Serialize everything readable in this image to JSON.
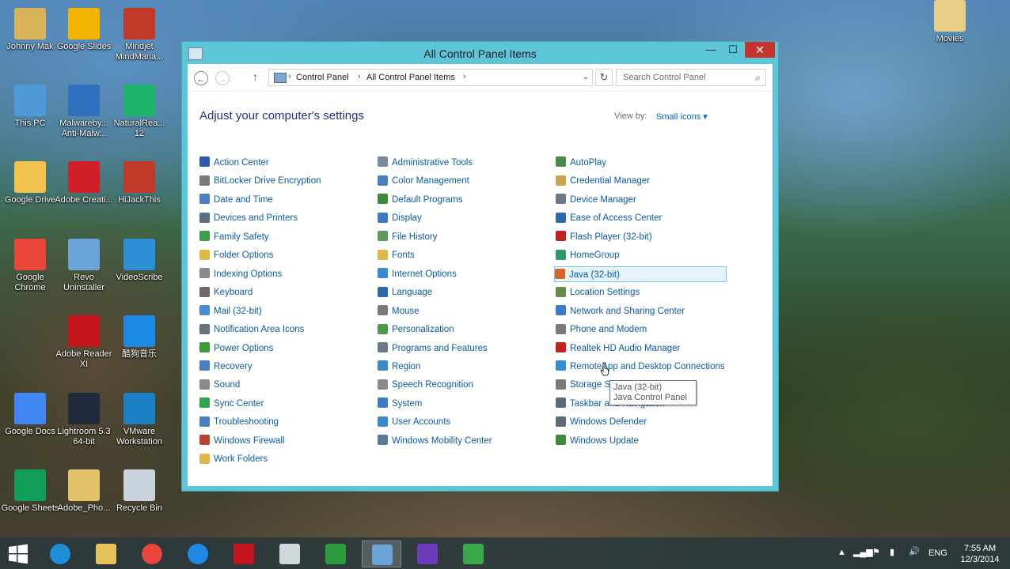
{
  "desktop": {
    "icons": [
      {
        "label": "Johnny Mak",
        "color": "#d9b35a",
        "icon": "folder-user-icon"
      },
      {
        "label": "Google Slides",
        "color": "#f3b400",
        "icon": "google-slides-icon"
      },
      {
        "label": "Mindjet MindMana...",
        "color": "#c0392b",
        "icon": "mindjet-icon"
      },
      {
        "label": "This PC",
        "color": "#4f9ad6",
        "icon": "computer-icon"
      },
      {
        "label": "Malwareby... Anti-Malw...",
        "color": "#2f6fbd",
        "icon": "malwarebytes-icon"
      },
      {
        "label": "NaturalRea... 12",
        "color": "#1fb36a",
        "icon": "naturalreader-icon"
      },
      {
        "label": "Google Drive",
        "color": "#f2c14e",
        "icon": "google-drive-icon"
      },
      {
        "label": "Adobe Creati...",
        "color": "#d11f2a",
        "icon": "adobe-cc-icon"
      },
      {
        "label": "HiJackThis",
        "color": "#c0392b",
        "icon": "hijackthis-icon"
      },
      {
        "label": "Google Chrome",
        "color": "#e9453a",
        "icon": "chrome-icon"
      },
      {
        "label": "Revo Uninstaller",
        "color": "#6ba4d8",
        "icon": "revo-icon"
      },
      {
        "label": "VideoScribe",
        "color": "#2e8fd6",
        "icon": "videoscribe-icon"
      },
      {
        "label": "Adobe Reader XI",
        "color": "#c4161c",
        "icon": "adobe-reader-icon"
      },
      {
        "label": "酷狗音乐",
        "color": "#1e88e5",
        "icon": "kugou-icon"
      },
      {
        "label": "Google Docs",
        "color": "#4285f4",
        "icon": "google-docs-icon"
      },
      {
        "label": "Lightroom 5.3 64-bit",
        "color": "#1f2b3a",
        "icon": "lightroom-icon"
      },
      {
        "label": "VMware Workstation",
        "color": "#1b7fc4",
        "icon": "vmware-icon"
      },
      {
        "label": "Google Sheets",
        "color": "#0f9d58",
        "icon": "google-sheets-icon"
      },
      {
        "label": "Adobe_Pho...",
        "color": "#e3c26a",
        "icon": "folder-icon"
      },
      {
        "label": "Recycle Bin",
        "color": "#c9d3dc",
        "icon": "recycle-bin-icon"
      },
      {
        "label": "Movies",
        "color": "#e8cf86",
        "icon": "folder-movies-icon"
      }
    ]
  },
  "window": {
    "title": "All Control Panel Items",
    "minimize": "—",
    "maximize": "☐",
    "close": "✕"
  },
  "address": {
    "crumb1": "Control Panel",
    "crumb2": "All Control Panel Items",
    "search_placeholder": "Search Control Panel"
  },
  "main": {
    "heading": "Adjust your computer's settings",
    "view_by_label": "View by:",
    "view_by_value": "Small icons ▾"
  },
  "items": [
    [
      {
        "label": "Action Center",
        "color": "#2a5caa"
      },
      {
        "label": "BitLocker Drive Encryption",
        "color": "#7a7a7a"
      },
      {
        "label": "Date and Time",
        "color": "#4a7fbf"
      },
      {
        "label": "Devices and Printers",
        "color": "#5a6e80"
      },
      {
        "label": "Family Safety",
        "color": "#3b9c4a"
      },
      {
        "label": "Folder Options",
        "color": "#e0b84a"
      },
      {
        "label": "Indexing Options",
        "color": "#8a8a8a"
      },
      {
        "label": "Keyboard",
        "color": "#6a6a6a"
      },
      {
        "label": "Mail (32-bit)",
        "color": "#4a8ad0"
      },
      {
        "label": "Notification Area Icons",
        "color": "#5f7480"
      },
      {
        "label": "Power Options",
        "color": "#3a9a3a"
      },
      {
        "label": "Recovery",
        "color": "#4a7fbf"
      },
      {
        "label": "Sound",
        "color": "#8a8a8a"
      },
      {
        "label": "Sync Center",
        "color": "#2ea64a"
      },
      {
        "label": "Troubleshooting",
        "color": "#4a7fbf"
      },
      {
        "label": "Windows Firewall",
        "color": "#b8432c"
      },
      {
        "label": "Work Folders",
        "color": "#e0b84a"
      }
    ],
    [
      {
        "label": "Administrative Tools",
        "color": "#7a8a9a"
      },
      {
        "label": "Color Management",
        "color": "#4a7fbf"
      },
      {
        "label": "Default Programs",
        "color": "#3a8a3a"
      },
      {
        "label": "Display",
        "color": "#3a7ac8"
      },
      {
        "label": "File History",
        "color": "#5a9a5a"
      },
      {
        "label": "Fonts",
        "color": "#e0b84a"
      },
      {
        "label": "Internet Options",
        "color": "#3a8ad0"
      },
      {
        "label": "Language",
        "color": "#2a6aaa"
      },
      {
        "label": "Mouse",
        "color": "#7a7a7a"
      },
      {
        "label": "Personalization",
        "color": "#4a9a4a"
      },
      {
        "label": "Programs and Features",
        "color": "#6a7a8a"
      },
      {
        "label": "Region",
        "color": "#3a8ad0"
      },
      {
        "label": "Speech Recognition",
        "color": "#8a8a8a"
      },
      {
        "label": "System",
        "color": "#3a7ac8"
      },
      {
        "label": "User Accounts",
        "color": "#3a8ad0"
      },
      {
        "label": "Windows Mobility Center",
        "color": "#5a7a9a"
      }
    ],
    [
      {
        "label": "AutoPlay",
        "color": "#4a8a4a"
      },
      {
        "label": "Credential Manager",
        "color": "#c8a44a"
      },
      {
        "label": "Device Manager",
        "color": "#6a7a8a"
      },
      {
        "label": "Ease of Access Center",
        "color": "#2a6ab0"
      },
      {
        "label": "Flash Player (32-bit)",
        "color": "#c0231e"
      },
      {
        "label": "HomeGroup",
        "color": "#2a9a6a"
      },
      {
        "label": "Java (32-bit)",
        "color": "#d8642a"
      },
      {
        "label": "Location Settings",
        "color": "#6a8a4a"
      },
      {
        "label": "Network and Sharing Center",
        "color": "#3a7ac8"
      },
      {
        "label": "Phone and Modem",
        "color": "#7a7a7a"
      },
      {
        "label": "Realtek HD Audio Manager",
        "color": "#c0231e"
      },
      {
        "label": "RemoteApp and Desktop Connections",
        "color": "#3a8ad0"
      },
      {
        "label": "Storage Spaces",
        "color": "#7a7a7a"
      },
      {
        "label": "Taskbar and Navigation",
        "color": "#5a6a7a"
      },
      {
        "label": "Windows Defender",
        "color": "#5a6a7a"
      },
      {
        "label": "Windows Update",
        "color": "#3a8a3a"
      }
    ]
  ],
  "tooltip": {
    "line1": "Java (32-bit)",
    "line2": "Java Control Panel"
  },
  "taskbar": {
    "apps": [
      {
        "icon": "internet-explorer-icon",
        "color": "#1e8fd6"
      },
      {
        "icon": "file-explorer-icon",
        "color": "#e6c35a"
      },
      {
        "icon": "chrome-icon",
        "color": "#e9453a"
      },
      {
        "icon": "kugou-icon",
        "color": "#1e88e5"
      },
      {
        "icon": "adobe-reader-icon",
        "color": "#c4161c"
      },
      {
        "icon": "calculator-icon",
        "color": "#d0d6dc"
      },
      {
        "icon": "camtasia-icon",
        "color": "#2a9a3a"
      },
      {
        "icon": "control-panel-icon",
        "color": "#6aa4d8"
      },
      {
        "icon": "settings-icon",
        "color": "#6a3ab8"
      },
      {
        "icon": "camtasia-recorder-icon",
        "color": "#3aa84a"
      }
    ],
    "language": "ENG",
    "time": "7:55 AM",
    "date": "12/3/2014"
  }
}
